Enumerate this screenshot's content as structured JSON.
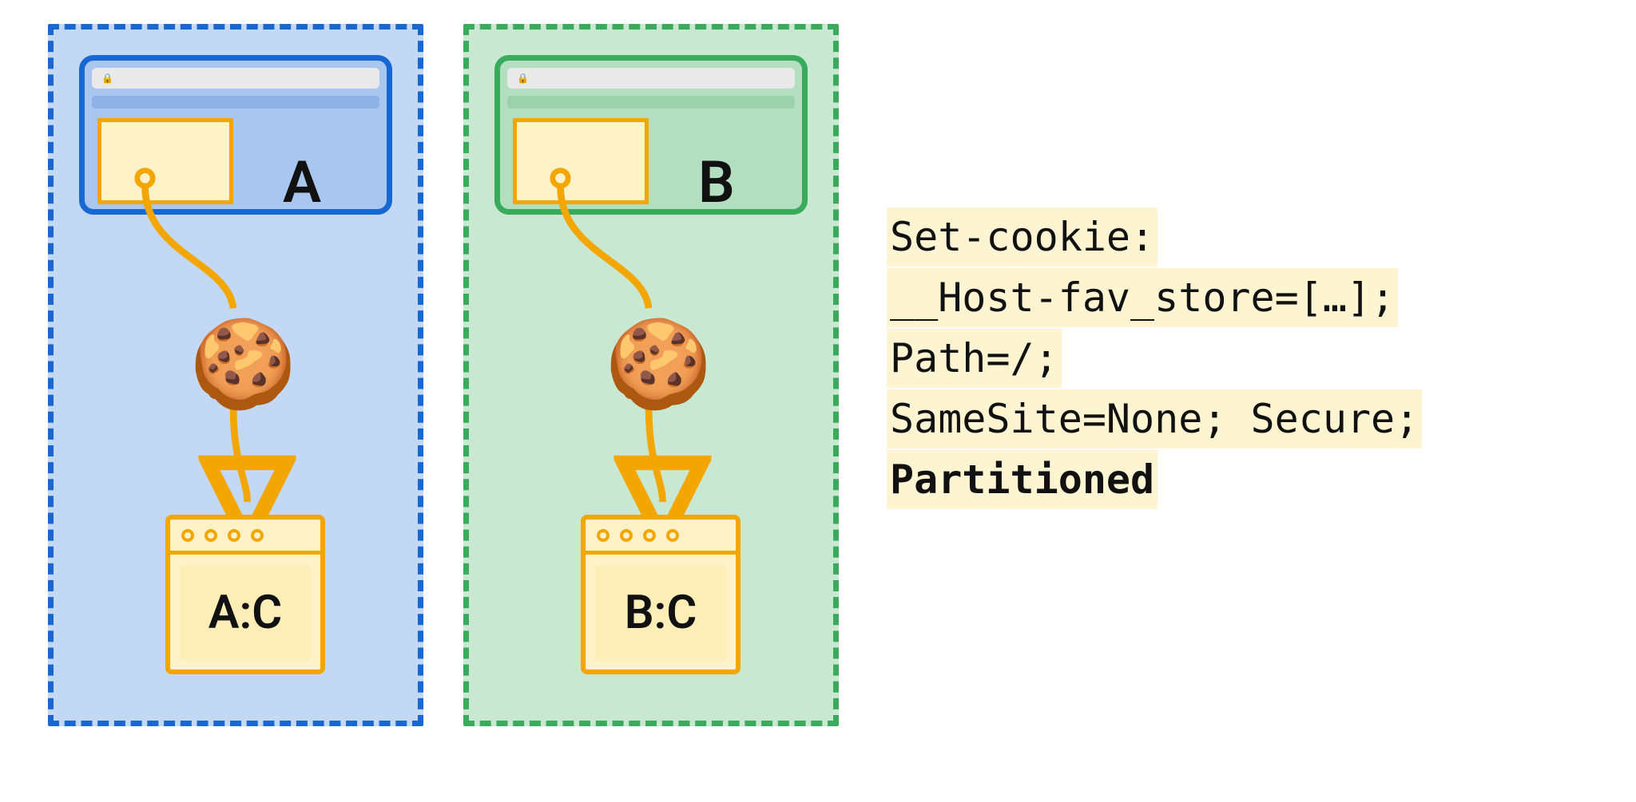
{
  "partitions": [
    {
      "site": "A",
      "jar": "A:C",
      "color": "blue"
    },
    {
      "site": "B",
      "jar": "B:C",
      "color": "green"
    }
  ],
  "code": {
    "l1": "Set-cookie:",
    "l2": "__Host-fav_store=[…];",
    "l3": "Path=/;",
    "l4": "SameSite=None; Secure;",
    "l5": "Partitioned"
  }
}
